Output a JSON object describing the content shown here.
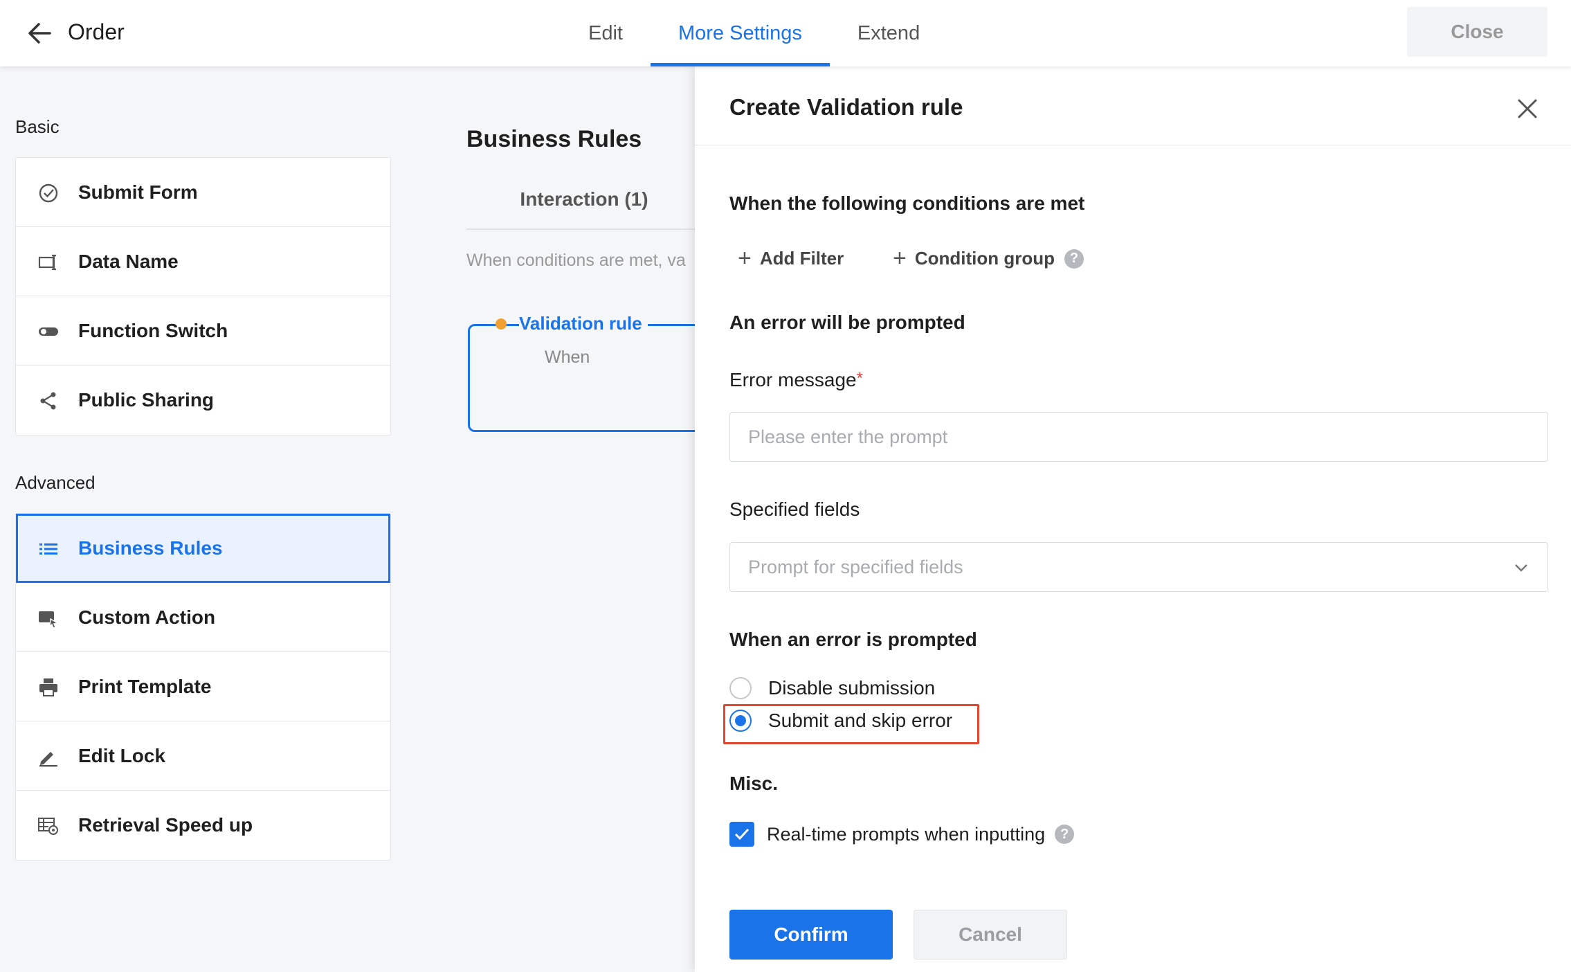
{
  "header": {
    "back_icon": "arrow-left-icon",
    "title": "Order",
    "tabs": [
      {
        "label": "Edit"
      },
      {
        "label": "More Settings"
      },
      {
        "label": "Extend"
      }
    ],
    "close_label": "Close"
  },
  "sidebar": {
    "basic_label": "Basic",
    "basic_items": [
      {
        "label": "Submit Form",
        "icon": "check-circle-icon"
      },
      {
        "label": "Data Name",
        "icon": "text-field-icon"
      },
      {
        "label": "Function Switch",
        "icon": "toggle-icon"
      },
      {
        "label": "Public Sharing",
        "icon": "share-icon"
      }
    ],
    "advanced_label": "Advanced",
    "advanced_items": [
      {
        "label": "Business Rules",
        "icon": "list-icon"
      },
      {
        "label": "Custom Action",
        "icon": "cursor-window-icon"
      },
      {
        "label": "Print Template",
        "icon": "printer-icon"
      },
      {
        "label": "Edit Lock",
        "icon": "pencil-icon"
      },
      {
        "label": "Retrieval Speed up",
        "icon": "table-gear-icon"
      }
    ]
  },
  "main": {
    "title": "Business Rules",
    "tab_label": "Interaction (1)",
    "description": "When conditions are met, va",
    "rule_name": "Validation rule",
    "rule_when": "When"
  },
  "drawer": {
    "title": "Create Validation rule",
    "conditions_heading": "When the following conditions are met",
    "add_filter_label": "Add Filter",
    "condition_group_label": "Condition group",
    "error_heading": "An error will be prompted",
    "error_message_label": "Error message",
    "required_mark": "*",
    "error_message_placeholder": "Please enter the prompt",
    "error_message_value": "",
    "specified_fields_label": "Specified fields",
    "specified_fields_placeholder": "Prompt for specified fields",
    "when_prompted_heading": "When an error is prompted",
    "options": [
      {
        "label": "Disable submission",
        "selected": false
      },
      {
        "label": "Submit and skip error",
        "selected": true
      }
    ],
    "misc_heading": "Misc.",
    "realtime_label": "Real-time prompts when inputting",
    "realtime_checked": true,
    "help_glyph": "?",
    "confirm_label": "Confirm",
    "cancel_label": "Cancel"
  },
  "colors": {
    "accent": "#1a73e8",
    "highlight": "#e0472e",
    "rule_dot": "#f0a030"
  }
}
